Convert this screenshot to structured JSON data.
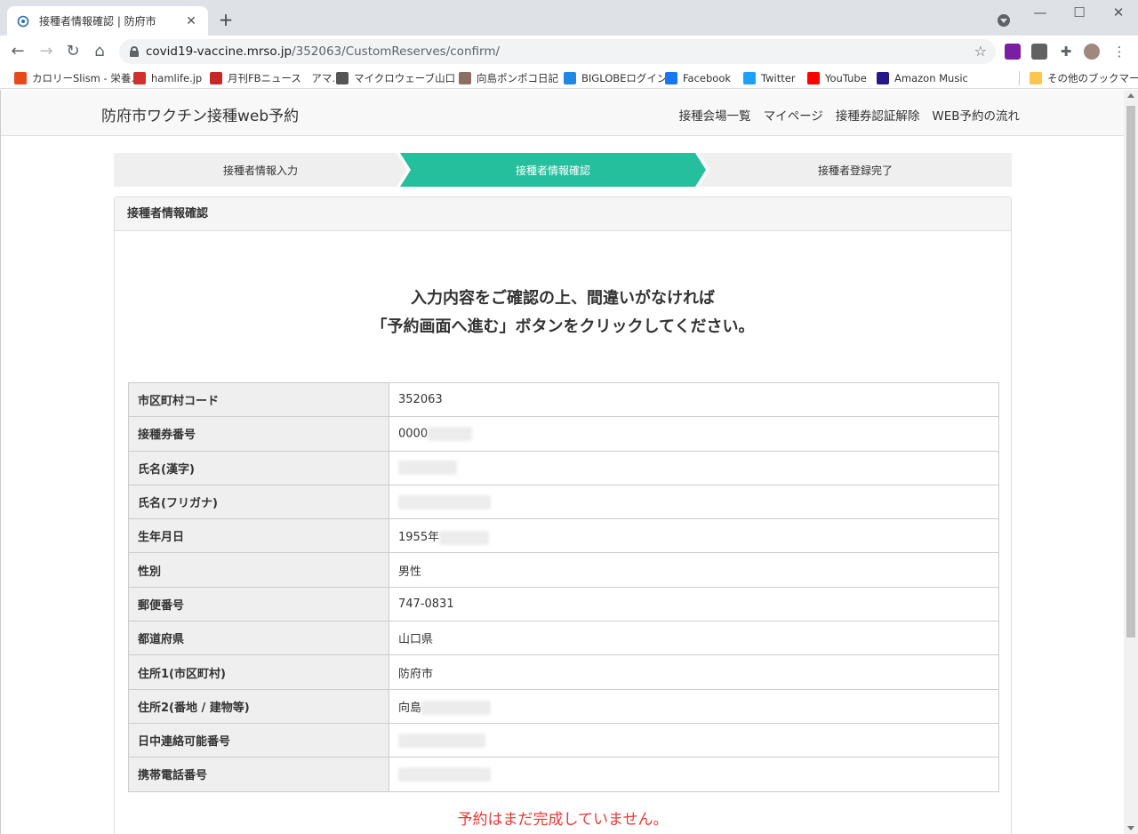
{
  "browser": {
    "tab_title": "接種者情報確認 | 防府市",
    "url_host": "covid19-vaccine.mrso.jp",
    "url_path": "/352063/CustomReserves/confirm/",
    "bookmarks": [
      {
        "label": "カロリーSlism - 栄養...",
        "icon": "slism-icon",
        "color": "#e64a19"
      },
      {
        "label": "hamlife.jp",
        "icon": "hamlife-icon",
        "color": "#d32f2f"
      },
      {
        "label": "月刊FBニュース　アマ...",
        "icon": "fb-news-icon",
        "color": "#c62828"
      },
      {
        "label": "マイクロウェーブ山口 -...",
        "icon": "microwave-icon",
        "color": "#555555"
      },
      {
        "label": "向島ポンポコ日記",
        "icon": "pompoko-icon",
        "color": "#8d6e63"
      },
      {
        "label": "BIGLOBEログイン",
        "icon": "biglobe-icon",
        "color": "#1e88e5"
      },
      {
        "label": "Facebook",
        "icon": "facebook-icon",
        "color": "#1877f2"
      },
      {
        "label": "Twitter",
        "icon": "twitter-icon",
        "color": "#1da1f2"
      },
      {
        "label": "YouTube",
        "icon": "youtube-icon",
        "color": "#ff0000"
      },
      {
        "label": "Amazon Music",
        "icon": "amazon-music-icon",
        "color": "#25168a"
      }
    ],
    "other_bookmarks": "その他のブックマーク"
  },
  "site": {
    "brand": "防府市ワクチン接種web予約",
    "nav": [
      "接種会場一覧",
      "マイページ",
      "接種券認証解除",
      "WEB予約の流れ"
    ]
  },
  "steps": [
    "接種者情報入力",
    "接種者情報確認",
    "接種者登録完了"
  ],
  "active_step": 1,
  "panel": {
    "title": "接種者情報確認",
    "notice_line1": "入力内容をご確認の上、間違いがなければ",
    "notice_line2": "「予約画面へ進む」ボタンをクリックしてください。"
  },
  "rows": [
    {
      "label": "市区町村コード",
      "value": "352063"
    },
    {
      "label": "接種券番号",
      "value": "0000"
    },
    {
      "label": "氏名(漢字)",
      "value": ""
    },
    {
      "label": "氏名(フリガナ)",
      "value": ""
    },
    {
      "label": "生年月日",
      "value": "1955年"
    },
    {
      "label": "性別",
      "value": "男性"
    },
    {
      "label": "郵便番号",
      "value": "747-0831"
    },
    {
      "label": "都道府県",
      "value": "山口県"
    },
    {
      "label": "住所1(市区町村)",
      "value": "防府市"
    },
    {
      "label": "住所2(番地 / 建物等)",
      "value": "向島"
    },
    {
      "label": "日中連絡可能番号",
      "value": ""
    },
    {
      "label": "携帯電話番号",
      "value": ""
    }
  ],
  "warning": "予約はまだ完成していません。",
  "colors": {
    "accent": "#26bf9d",
    "warning": "#e53935"
  }
}
